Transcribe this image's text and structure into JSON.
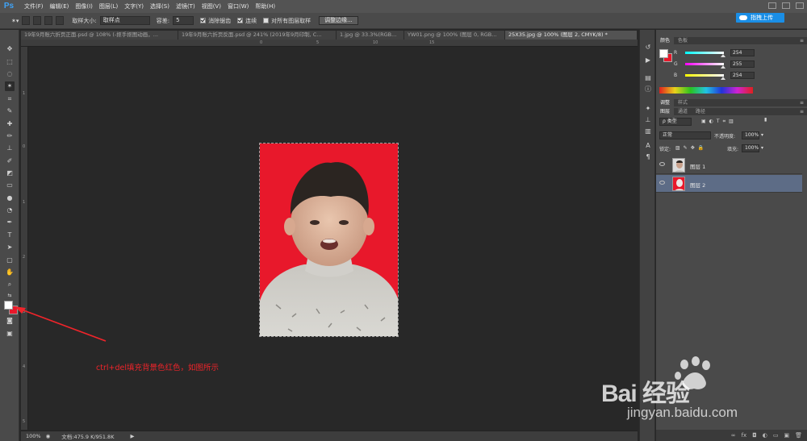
{
  "app": {
    "logo": "Ps"
  },
  "menu": [
    "文件(F)",
    "编辑(E)",
    "图像(I)",
    "图层(L)",
    "文字(Y)",
    "选择(S)",
    "滤镜(T)",
    "视图(V)",
    "窗口(W)",
    "帮助(H)"
  ],
  "options": {
    "sample_size_label": "取样大小:",
    "sample_size_value": "取样点",
    "tolerance_label": "容差:",
    "tolerance_value": "5",
    "antialias_label": "消除锯齿",
    "contiguous_label": "连续",
    "all_layers_label": "对所有图层取样",
    "refine_button": "调整边缘...",
    "share_button": "指拽上传"
  },
  "tabs": [
    {
      "label": "19年9月账六折页正面.psd @ 108% (-抠手抠图动画，...",
      "active": false
    },
    {
      "label": "19年9月账六折页反面.psd @ 241% (2019年9月印制, C...",
      "active": false
    },
    {
      "label": "1.jpg @ 33.3%(RGB...",
      "active": false
    },
    {
      "label": "YW01.png @ 100% (图层 0, RGB...",
      "active": false
    },
    {
      "label": "25X35.jpg @ 100% (图层 2, CMYK/8) *",
      "active": true
    }
  ],
  "ruler_top_ticks": [
    "0",
    "5",
    "10",
    "15"
  ],
  "ruler_left_ticks": [
    "1",
    "0",
    "1",
    "2",
    "3",
    "4",
    "5"
  ],
  "status": {
    "zoom": "100%",
    "doc": "文档:475.9 K/951.8K"
  },
  "annotation": {
    "text": "ctrl+del填充背景色红色，如图所示"
  },
  "swatches": {
    "foreground": "#ffffff",
    "background": "#e8182b"
  },
  "color_panel": {
    "tabs": [
      "颜色",
      "色板"
    ],
    "channels": [
      {
        "label": "R",
        "value": "254",
        "gradient": "linear-gradient(90deg,#00ffff,#ffffff)"
      },
      {
        "label": "G",
        "value": "255",
        "gradient": "linear-gradient(90deg,#ff00ff,#ffffff)"
      },
      {
        "label": "B",
        "value": "254",
        "gradient": "linear-gradient(90deg,#ffff00,#ffffff)"
      }
    ]
  },
  "adjust_panel": {
    "tabs": [
      "调整",
      "样式"
    ]
  },
  "layers_panel": {
    "tabs": [
      "图层",
      "通道",
      "路径"
    ],
    "filter_kind": "类型",
    "blend_mode": "正常",
    "opacity_label": "不透明度:",
    "opacity_value": "100%",
    "lock_label": "锁定:",
    "fill_label": "填充:",
    "fill_value": "100%",
    "layers": [
      {
        "name": "图层 1",
        "selected": false
      },
      {
        "name": "图层 2",
        "selected": true
      }
    ]
  },
  "watermark": {
    "brand": "Bai  经验",
    "url": "jingyan.baidu.com"
  }
}
